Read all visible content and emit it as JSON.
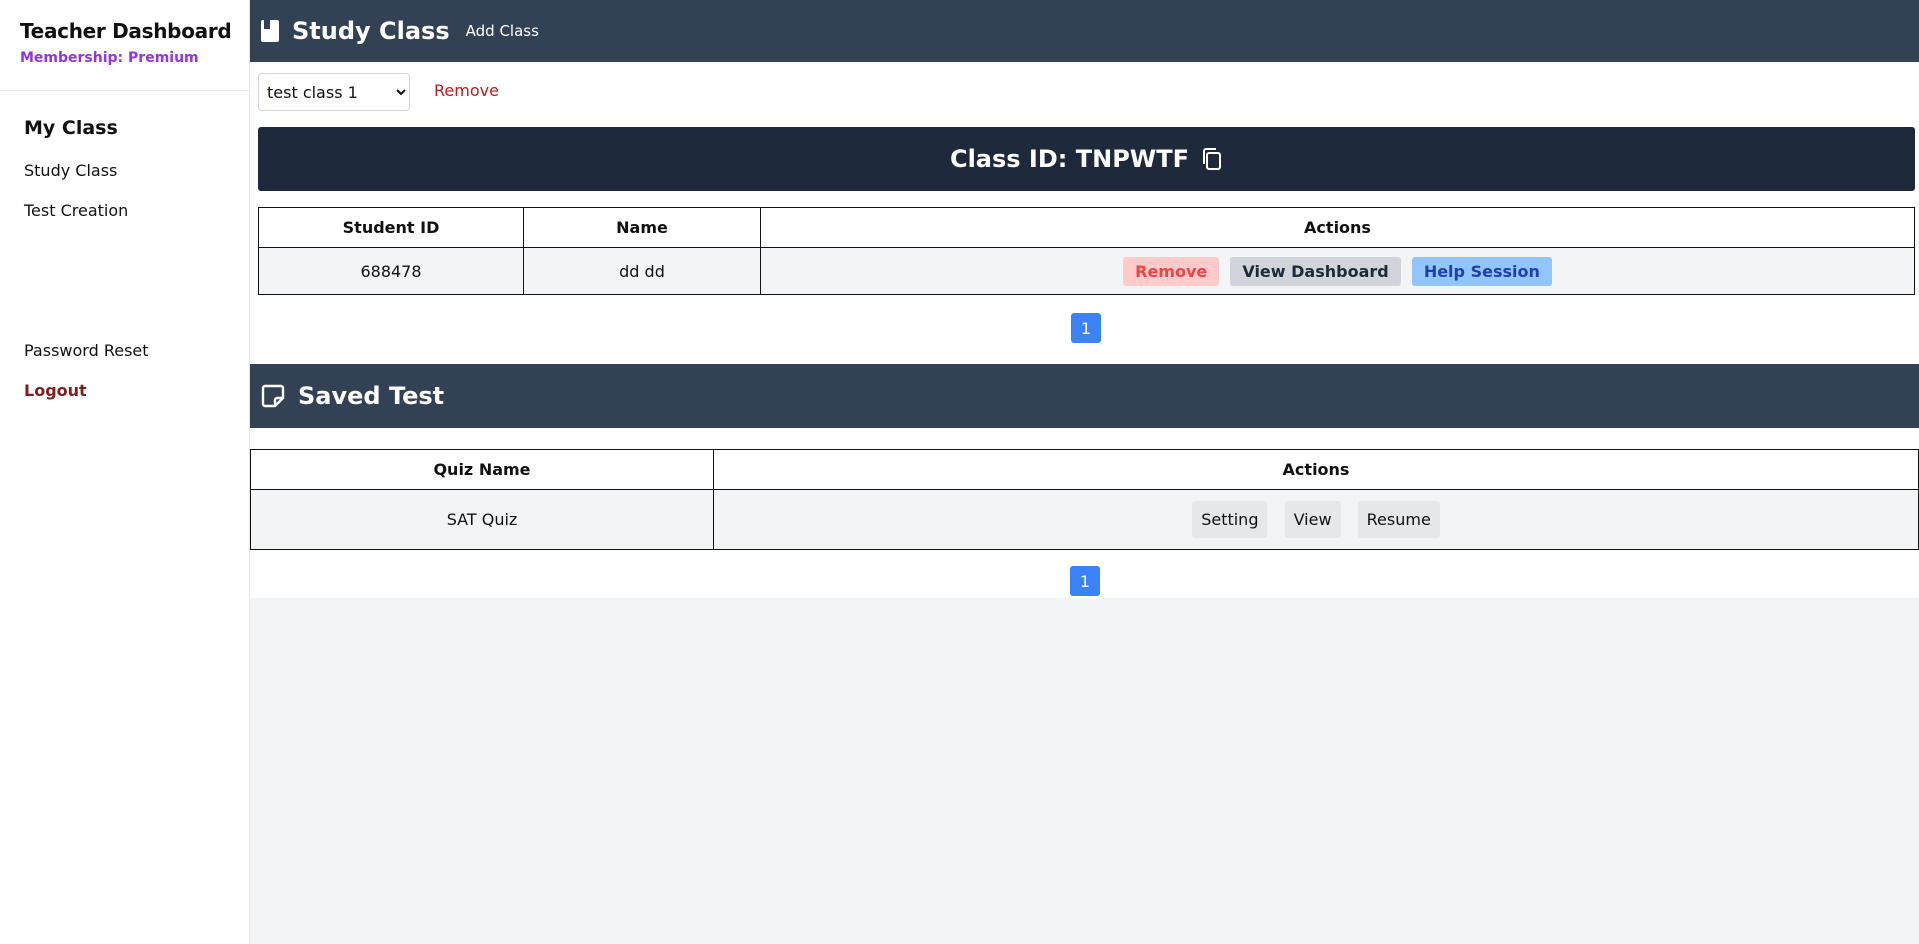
{
  "sidebar": {
    "title": "Teacher Dashboard",
    "membership": "Membership: Premium",
    "heading": "My Class",
    "items": [
      {
        "label": "Study Class"
      },
      {
        "label": "Test Creation"
      }
    ],
    "password_reset": "Password Reset",
    "logout": "Logout"
  },
  "study_class": {
    "title": "Study Class",
    "add_class": "Add Class",
    "selected_class": "test class 1",
    "remove_label": "Remove",
    "class_id": "Class ID: TNPWTF",
    "table": {
      "headers": [
        "Student ID",
        "Name",
        "Actions"
      ],
      "rows": [
        {
          "student_id": "688478",
          "name": "dd dd"
        }
      ],
      "actions": [
        "Remove",
        "View Dashboard",
        "Help Session"
      ]
    },
    "page": "1"
  },
  "saved_test": {
    "title": "Saved Test",
    "table": {
      "headers": [
        "Quiz Name",
        "Actions"
      ],
      "rows": [
        {
          "quiz_name": "SAT Quiz"
        }
      ],
      "actions": [
        "Setting",
        "View",
        "Resume"
      ]
    },
    "page": "1"
  },
  "colors": {
    "header_bar": "#334155",
    "class_id_bar": "#1e293b",
    "pagination": "#3b82f6",
    "logout": "#7f1d1d",
    "membership": "#9333ea"
  },
  "icons": [
    "book-icon",
    "copy-icon",
    "note-icon",
    "chevron-down-icon"
  ]
}
